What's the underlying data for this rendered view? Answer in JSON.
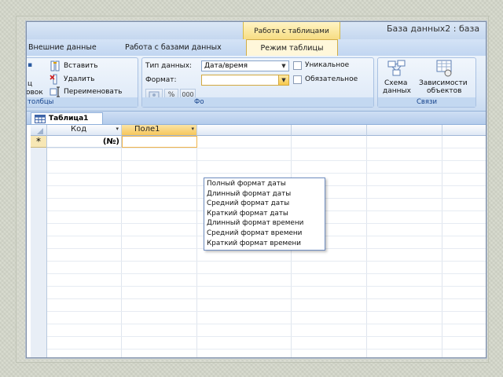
{
  "window": {
    "context_header": "Работа с таблицами",
    "app_title": "База данных2 : база"
  },
  "tabs": [
    {
      "label": "Внешние данные"
    },
    {
      "label": "Работа с базами данных"
    },
    {
      "label": "Режим таблицы"
    }
  ],
  "ribbon": {
    "fields_group": {
      "insert": "Вставить",
      "delete": "Удалить",
      "rename": "Переименовать",
      "left_partial_1": "ц",
      "left_partial_2": "овок",
      "label": "толбцы"
    },
    "format_group": {
      "datatype_label": "Тип данных:",
      "datatype_value": "Дата/время",
      "format_label": "Формат:",
      "format_value": "",
      "percent": "%",
      "thousands": "000",
      "unique_label": "Уникальное",
      "required_label": "Обязательное",
      "label": "Фо"
    },
    "relations_group": {
      "schema_line1": "Схема",
      "schema_line2": "данных",
      "deps_line1": "Зависимости",
      "deps_line2": "объектов",
      "label": "Связи"
    }
  },
  "document": {
    "tab_title": "Таблица1",
    "columns": [
      {
        "label": "Код"
      },
      {
        "label": "Поле1"
      }
    ],
    "new_row_marker": "*",
    "new_row_value": "(№)"
  },
  "format_dropdown": {
    "options": [
      "Полный формат даты",
      "Длинный формат даты",
      "Средний формат даты",
      "Краткий формат даты",
      "Длинный формат времени",
      "Средний формат времени",
      "Краткий формат времени"
    ]
  }
}
